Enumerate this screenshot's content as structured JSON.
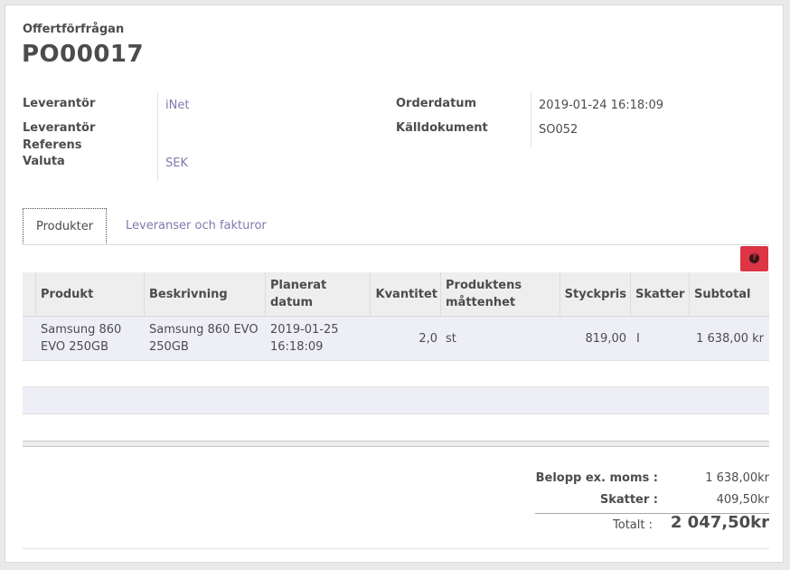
{
  "header": {
    "doc_type": "Offertförfrågan",
    "doc_name": "PO00017"
  },
  "fields": {
    "vendor_label": "Leverantör",
    "vendor_value": "iNet",
    "vendor_ref_label_1": "Leverantör",
    "vendor_ref_label_2": "Referens",
    "vendor_ref_value": "",
    "currency_label": "Valuta",
    "currency_value": "SEK",
    "order_date_label": "Orderdatum",
    "order_date_value": "2019-01-24 16:18:09",
    "source_doc_label": "Källdokument",
    "source_doc_value": "SO052"
  },
  "tabs": [
    {
      "label": "Produkter",
      "active": true
    },
    {
      "label": "Leveranser och fakturor",
      "active": false
    }
  ],
  "help_button": {
    "icon": "question-circle-icon",
    "color": "#dc3545"
  },
  "table": {
    "headers": {
      "product": "Produkt",
      "description": "Beskrivning",
      "planned_date_1": "Planerat",
      "planned_date_2": "datum",
      "quantity": "Kvantitet",
      "uom_1": "Produktens",
      "uom_2": "måttenhet",
      "unit_price": "Styckpris",
      "taxes": "Skatter",
      "subtotal": "Subtotal"
    },
    "rows": [
      {
        "product_1": "Samsung 860",
        "product_2": "EVO 250GB",
        "description_1": "Samsung 860 EVO",
        "description_2": "250GB",
        "date_1": "2019-01-25",
        "date_2": "16:18:09",
        "quantity": "2,0",
        "uom": "st",
        "unit_price": "819,00",
        "taxes": "I",
        "subtotal": "1 638,00 kr"
      }
    ]
  },
  "totals": {
    "untaxed_label": "Belopp ex. moms :",
    "untaxed_value": "1 638,00kr",
    "taxes_label": "Skatter :",
    "taxes_value": "409,50kr",
    "total_label": "Totalt :",
    "total_value": "2 047,50kr"
  },
  "colors": {
    "link": "#7c7bad",
    "row_bg": "#eeeef6",
    "header_bg": "#eeeeee",
    "help_red": "#dc3545"
  }
}
